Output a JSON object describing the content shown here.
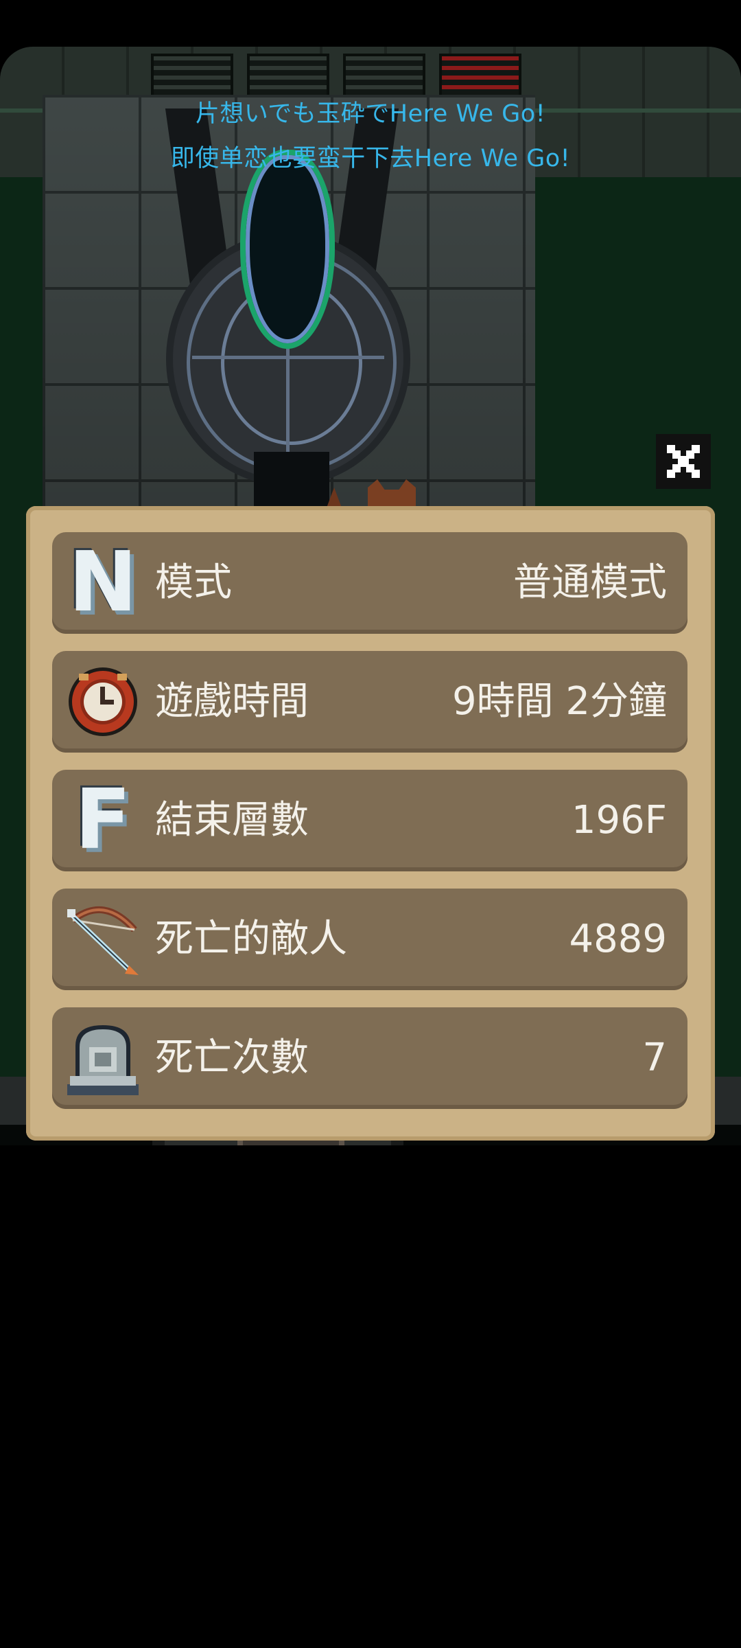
{
  "lyrics": {
    "line1": "片想いでも玉砕でHere We Go!",
    "line2": "即使单恋也要蛮干下去Here We Go!"
  },
  "close_button": {
    "icon": "close-icon"
  },
  "stats": [
    {
      "icon": "letter-n-icon",
      "label": "模式",
      "value": "普通模式"
    },
    {
      "icon": "clock-icon",
      "label": "遊戲時間",
      "value": "9時間 2分鐘"
    },
    {
      "icon": "letter-f-icon",
      "label": "結束層數",
      "value": "196F"
    },
    {
      "icon": "bow-icon",
      "label": "死亡的敵人",
      "value": "4889"
    },
    {
      "icon": "tombstone-icon",
      "label": "死亡次數",
      "value": "7"
    }
  ],
  "colors": {
    "lyric": "#37b7ea",
    "panel_frame": "#cbb286",
    "row_background": "#7f6d54",
    "text": "#f4f1ea"
  }
}
